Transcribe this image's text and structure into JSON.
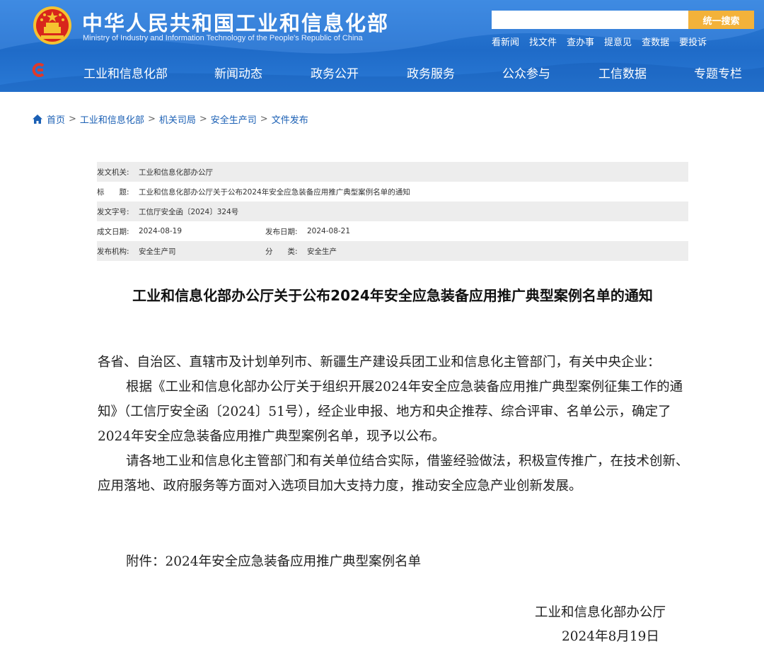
{
  "header": {
    "site_title": "中华人民共和国工业和信息化部",
    "site_subtitle": "Ministry of Industry and Information Technology of the People's Republic of China",
    "search_placeholder": "",
    "search_button": "统一搜索",
    "quick_links": [
      "看新闻",
      "找文件",
      "查办事",
      "提意见",
      "查数据",
      "要投诉"
    ],
    "nav": [
      "工业和信息化部",
      "新闻动态",
      "政务公开",
      "政务服务",
      "公众参与",
      "工信数据",
      "专题专栏"
    ],
    "colors": {
      "header_blue": "#2a76d2",
      "search_button": "#f3b23a"
    }
  },
  "breadcrumb": [
    "首页",
    "工业和信息化部",
    "机关司局",
    "安全生产司",
    "文件发布"
  ],
  "meta": {
    "issuer_label": "发文机关:",
    "issuer_value": "工业和信息化部办公厅",
    "title_label": "标　　题:",
    "title_value": "工业和信息化部办公厅关于公布2024年安全应急装备应用推广典型案例名单的通知",
    "doc_number_label": "发文字号:",
    "doc_number_value": "工信厅安全函〔2024〕324号",
    "created_label": "成文日期:",
    "created_value": "2024-08-19",
    "published_label": "发布日期:",
    "published_value": "2024-08-21",
    "org_label": "发布机构:",
    "org_value": "安全生产司",
    "category_label": "分　　类:",
    "category_value": "安全生产"
  },
  "document": {
    "title": "工业和信息化部办公厅关于公布2024年安全应急装备应用推广典型案例名单的通知",
    "salutation": "各省、自治区、直辖市及计划单列市、新疆生产建设兵团工业和信息化主管部门，有关中央企业：",
    "paragraph1": "根据《工业和信息化部办公厅关于组织开展2024年安全应急装备应用推广典型案例征集工作的通知》（工信厅安全函〔2024〕51号），经企业申报、地方和央企推荐、综合评审、名单公示，确定了2024年安全应急装备应用推广典型案例名单，现予以公布。",
    "paragraph2": "请各地工业和信息化主管部门和有关单位结合实际，借鉴经验做法，积极宣传推广，在技术创新、应用落地、政府服务等方面对入选项目加大支持力度，推动安全应急产业创新发展。",
    "attachment": "附件：2024年安全应急装备应用推广典型案例名单",
    "signature": "工业和信息化部办公厅",
    "date": "2024年8月19日"
  },
  "icons": [
    "national-emblem-icon",
    "site-logo-icon",
    "home-icon"
  ]
}
